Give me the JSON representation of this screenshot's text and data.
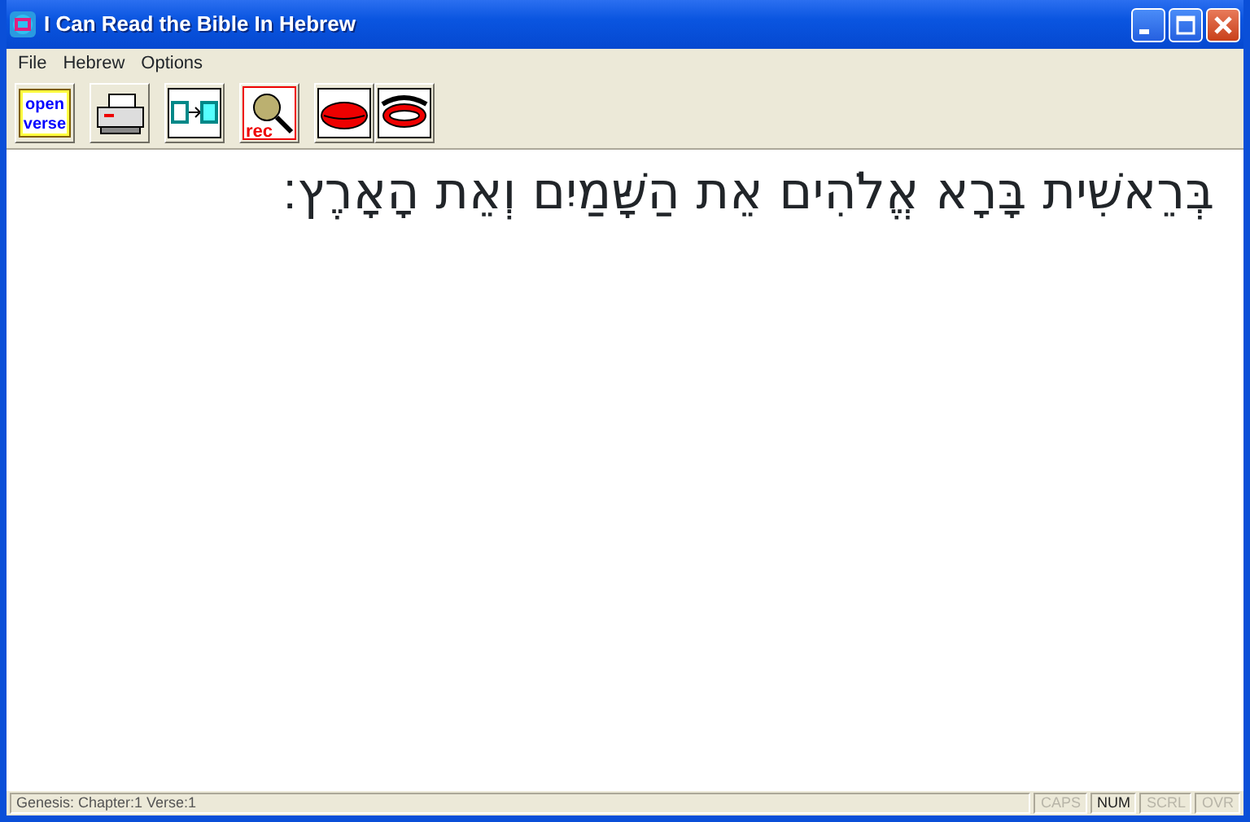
{
  "window": {
    "title": "I Can Read the Bible In Hebrew",
    "controls": [
      {
        "kind": "minimize"
      },
      {
        "kind": "maximize"
      },
      {
        "kind": "close"
      }
    ]
  },
  "menu": [
    "File",
    "Hebrew",
    "Options"
  ],
  "toolbar": [
    {
      "kind": "open-verse",
      "lines": [
        "open",
        "verse"
      ]
    },
    {
      "kind": "print"
    },
    {
      "kind": "transfer"
    },
    {
      "kind": "record",
      "label": "rec"
    },
    {
      "kind": "lips"
    },
    {
      "kind": "mouth"
    }
  ],
  "verse": "בְּרֵאשִׁית בָּרָא אֱלֹהִים אֵת הַשָּׁמַיִם וְאֵת הָאָרֶץ׃",
  "status_bar": {
    "location": "Genesis: Chapter:1 Verse:1",
    "indicators": [
      {
        "label": "CAPS",
        "on": false
      },
      {
        "label": "NUM",
        "on": true
      },
      {
        "label": "SCRL",
        "on": false
      },
      {
        "label": "OVR",
        "on": false
      }
    ]
  }
}
